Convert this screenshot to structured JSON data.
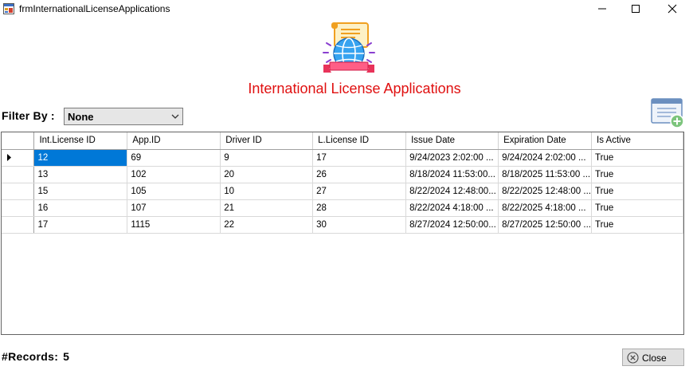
{
  "window": {
    "title": "frmInternationalLicenseApplications",
    "icon": "app-form-icon"
  },
  "header": {
    "logo": "globe-certificate-icon",
    "title": "International License Applications",
    "title_color": "#e01010"
  },
  "filter": {
    "label": "Filter By :",
    "selected": "None"
  },
  "add_button": {
    "icon": "add-application-icon"
  },
  "grid": {
    "columns": [
      "Int.License ID",
      "App.ID",
      "Driver ID",
      "L.License ID",
      "Issue Date",
      "Expiration Date",
      "Is Active"
    ],
    "rows": [
      [
        "12",
        "69",
        "9",
        "17",
        "9/24/2023 2:02:00 ...",
        "9/24/2024 2:02:00 ...",
        "True"
      ],
      [
        "13",
        "102",
        "20",
        "26",
        "8/18/2024 11:53:00...",
        "8/18/2025 11:53:00 ...",
        "True"
      ],
      [
        "15",
        "105",
        "10",
        "27",
        "8/22/2024 12:48:00...",
        "8/22/2025 12:48:00 ...",
        "True"
      ],
      [
        "16",
        "107",
        "21",
        "28",
        "8/22/2024 4:18:00 ...",
        "8/22/2025 4:18:00 ...",
        "True"
      ],
      [
        "17",
        "1115",
        "22",
        "30",
        "8/27/2024 12:50:00...",
        "8/27/2025 12:50:00 ...",
        "True"
      ]
    ],
    "selection_color": "#0078d7"
  },
  "footer": {
    "records_label": "#Records:",
    "records_count": "5",
    "close_label": "Close"
  }
}
